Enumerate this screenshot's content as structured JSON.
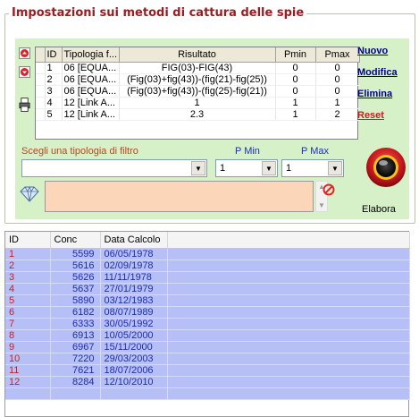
{
  "title": "Impostazioni sui metodi di cattura delle spie",
  "grid": {
    "columns": [
      "ID",
      "Tipologia f...",
      "Risultato",
      "Pmin",
      "Pmax"
    ],
    "rows": [
      {
        "id": "1",
        "tipo": "06 [EQUA...",
        "risultato": "FIG(03)-FIG(43)",
        "pmin": "0",
        "pmax": "0"
      },
      {
        "id": "2",
        "tipo": "06 [EQUA...",
        "risultato": "(Fig(03)+fig(43))-(fig(21)-fig(25))",
        "pmin": "0",
        "pmax": "0"
      },
      {
        "id": "3",
        "tipo": "06 [EQUA...",
        "risultato": "(Fig(03)+fig(43))-(fig(25)-fig(21))",
        "pmin": "0",
        "pmax": "0"
      },
      {
        "id": "4",
        "tipo": "12 [Link A...",
        "risultato": "1",
        "pmin": "1",
        "pmax": "1"
      },
      {
        "id": "5",
        "tipo": "12 [Link A...",
        "risultato": "2.3",
        "pmin": "1",
        "pmax": "2"
      }
    ]
  },
  "actions": {
    "nuovo": "Nuovo",
    "modifica": "Modifica",
    "elimina": "Elimina",
    "reset": "Reset"
  },
  "filter": {
    "label": "Scegli una tipologia di filtro",
    "value": "",
    "pmin_label": "P Min",
    "pmin_value": "1",
    "pmax_label": "P Max",
    "pmax_value": "1"
  },
  "formula": {
    "value": ""
  },
  "elabora": {
    "label": "Elabora"
  },
  "results": {
    "columns": [
      "ID",
      "Conc",
      "Data Calcolo"
    ],
    "rows": [
      {
        "id": "1",
        "conc": "5599",
        "data": "06/05/1978"
      },
      {
        "id": "2",
        "conc": "5616",
        "data": "02/09/1978"
      },
      {
        "id": "3",
        "conc": "5626",
        "data": "11/11/1978"
      },
      {
        "id": "4",
        "conc": "5637",
        "data": "27/01/1979"
      },
      {
        "id": "5",
        "conc": "5890",
        "data": "03/12/1983"
      },
      {
        "id": "6",
        "conc": "6182",
        "data": "08/07/1989"
      },
      {
        "id": "7",
        "conc": "6333",
        "data": "30/05/1992"
      },
      {
        "id": "8",
        "conc": "6913",
        "data": "10/05/2000"
      },
      {
        "id": "9",
        "conc": "6967",
        "data": "15/11/2000"
      },
      {
        "id": "10",
        "conc": "7220",
        "data": "29/03/2003"
      },
      {
        "id": "11",
        "conc": "7621",
        "data": "18/07/2006"
      },
      {
        "id": "12",
        "conc": "8284",
        "data": "12/10/2010"
      }
    ]
  },
  "colors": {
    "accent_red": "#9b1c22",
    "panel_bg": "#d6f0c8",
    "results_bg": "#b7bff7",
    "link_blue": "#00008b"
  }
}
